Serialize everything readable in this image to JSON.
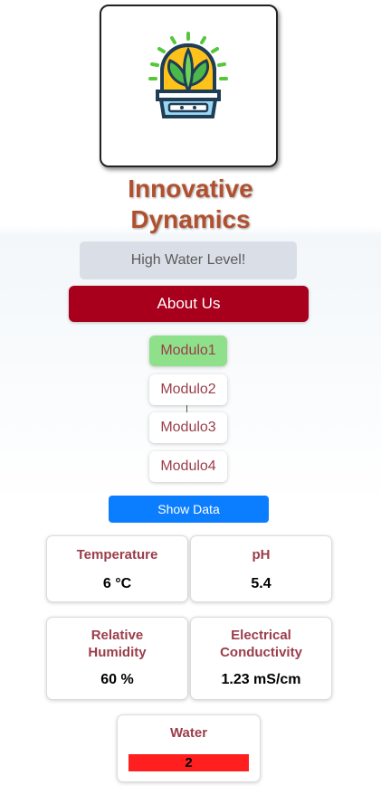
{
  "brand": {
    "line1": "Innovative",
    "line2": "Dynamics",
    "logo_icon": "greenhouse-plant-icon",
    "color": "#b0502f"
  },
  "alert": {
    "text": "High Water Level!"
  },
  "about_button": {
    "label": "About Us",
    "color": "#a8001c"
  },
  "modules": [
    {
      "label": "Modulo1",
      "active": true
    },
    {
      "label": "Modulo2",
      "active": false
    },
    {
      "label": "Modulo3",
      "active": false
    },
    {
      "label": "Modulo4",
      "active": false
    }
  ],
  "show_data_button": {
    "label": "Show Data",
    "color": "#0b7dff"
  },
  "sensors": {
    "temperature": {
      "title": "Temperature",
      "value": "6 °C"
    },
    "ph": {
      "title": "pH",
      "value": "5.4"
    },
    "humidity": {
      "title": "Relative Humidity",
      "value": "60 %"
    },
    "conductivity": {
      "title": "Electrical Conductivity",
      "value": "1.23 mS/cm"
    },
    "water": {
      "title": "Water",
      "value": "2",
      "status_color": "#ff1f1f"
    }
  }
}
